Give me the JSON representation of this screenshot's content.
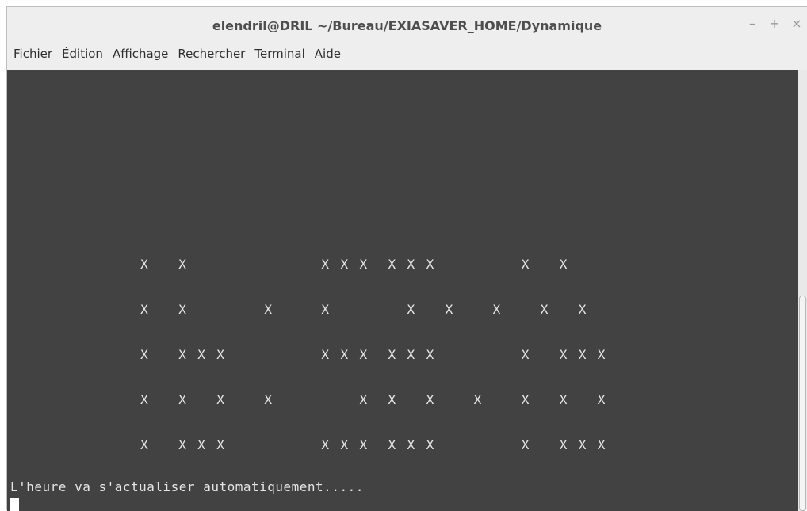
{
  "window": {
    "title": "elendril@DRIL ~/Bureau/EXIASAVER_HOME/Dynamique",
    "buttons": {
      "minimize": "–",
      "maximize": "+",
      "close": "×"
    }
  },
  "menubar": {
    "items": [
      "Fichier",
      "Édition",
      "Affichage",
      "Rechercher",
      "Terminal",
      "Aide"
    ]
  },
  "terminal": {
    "clock_lines": [
      "              X   X              X X X  X X X         X   X",
      "              X   X        X     X        X   X    X    X   X",
      "              X   X X X          X X X  X X X         X   X X X",
      "              X   X   X    X         X  X   X    X    X   X   X",
      "              X   X X X          X X X  X X X         X   X X X"
    ],
    "status_message": "L'heure va s'actualiser automatiquement.....",
    "background_color": "#424242",
    "text_color": "#e6e6e6"
  }
}
